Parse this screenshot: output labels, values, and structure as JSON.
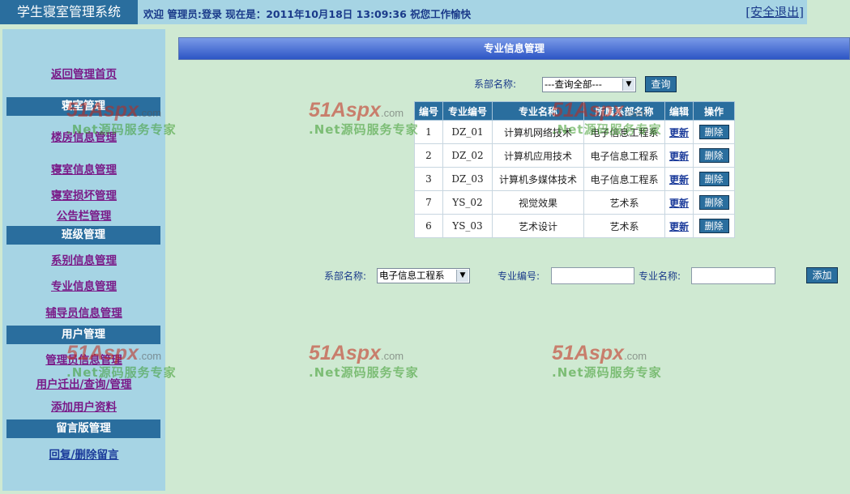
{
  "header": {
    "system_title": "学生寝室管理系统",
    "welcome_text": "欢迎 管理员:登录 现在是：2011年10月18日 13:09:36 祝您工作愉快",
    "logout_label": "[安全退出]"
  },
  "sidebar": {
    "home_link": "返回管理首页",
    "dorm": {
      "title": "寝室管理",
      "items": [
        "楼房信息管理",
        "寝室信息管理",
        "寝室损坏管理",
        "公告栏管理"
      ]
    },
    "class": {
      "title": "班级管理",
      "items": [
        "系别信息管理",
        "专业信息管理",
        "辅导员信息管理"
      ]
    },
    "user": {
      "title": "用户管理",
      "items": [
        "管理员信息管理",
        "用户迁出/查询/管理",
        "添加用户资料"
      ]
    },
    "message": {
      "title": "留言版管理",
      "items": [
        "回复/删除留言"
      ]
    }
  },
  "main": {
    "panel_title": "专业信息管理",
    "search": {
      "dept_label": "系部名称:",
      "dept_selected": "---查询全部---",
      "query_button": "查询"
    },
    "table": {
      "headers": [
        "编号",
        "专业编号",
        "专业名称",
        "所属系部名称",
        "编辑",
        "操作"
      ],
      "rows": [
        {
          "id": "1",
          "code": "DZ_01",
          "name": "计算机网络技术",
          "dept": "电子信息工程系",
          "edit": "更新",
          "action": "删除"
        },
        {
          "id": "2",
          "code": "DZ_02",
          "name": "计算机应用技术",
          "dept": "电子信息工程系",
          "edit": "更新",
          "action": "删除"
        },
        {
          "id": "3",
          "code": "DZ_03",
          "name": "计算机多媒体技术",
          "dept": "电子信息工程系",
          "edit": "更新",
          "action": "删除"
        },
        {
          "id": "7",
          "code": "YS_02",
          "name": "视觉效果",
          "dept": "艺术系",
          "edit": "更新",
          "action": "删除"
        },
        {
          "id": "6",
          "code": "YS_03",
          "name": "艺术设计",
          "dept": "艺术系",
          "edit": "更新",
          "action": "删除"
        }
      ]
    },
    "add_form": {
      "dept_label": "系部名称:",
      "dept_selected": "电子信息工程系",
      "code_label": "专业编号:",
      "code_value": "",
      "name_label": "专业名称:",
      "name_value": "",
      "add_button": "添加"
    }
  },
  "watermark": {
    "brand": "51Aspx",
    "suffix": ".com",
    "slogan": ".Net源码服务专家"
  }
}
